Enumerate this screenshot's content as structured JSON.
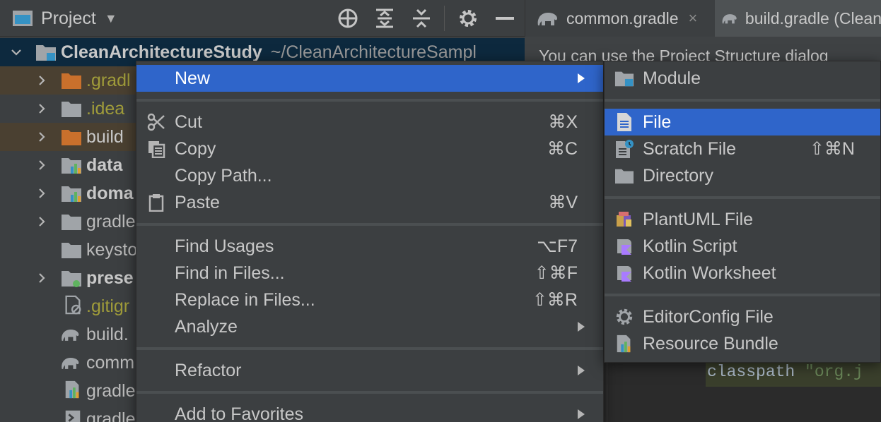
{
  "project_header": {
    "title": "Project"
  },
  "tree": [
    {
      "label": "CleanArchitectureStudy",
      "path": "~/CleanArchitectureSampl",
      "icon": "module-folder-icon"
    },
    {
      "label": ".gradl",
      "icon": "orange-folder-icon"
    },
    {
      "label": ".idea",
      "icon": "folder-icon"
    },
    {
      "label": "build",
      "icon": "orange-folder-icon"
    },
    {
      "label": "data",
      "icon": "module-folder-icon"
    },
    {
      "label": "doma",
      "icon": "module-folder-icon"
    },
    {
      "label": "gradle",
      "icon": "folder-icon"
    },
    {
      "label": "keysto",
      "icon": "folder-icon"
    },
    {
      "label": "prese",
      "icon": "app-module-folder-icon"
    },
    {
      "label": ".gitigr",
      "icon": "gitignore-file-icon"
    },
    {
      "label": "build.",
      "icon": "gradle-elephant-icon"
    },
    {
      "label": "comm",
      "icon": "gradle-elephant-icon"
    },
    {
      "label": "gradle",
      "icon": "properties-file-icon"
    },
    {
      "label": "gradle",
      "icon": "script-file-icon"
    }
  ],
  "editor": {
    "tabs": [
      {
        "label": "common.gradle",
        "close": "×"
      },
      {
        "label": "build.gradle (Clean"
      }
    ],
    "banner": "You can use the Project Structure dialog",
    "code": {
      "keyword": "classpath",
      "string": "\"org.j"
    }
  },
  "context_menu": {
    "items": [
      {
        "label": "New",
        "shortcut": "",
        "submenu": true
      },
      {
        "label": "Cut",
        "shortcut": "⌘X",
        "icon": "scissors-icon"
      },
      {
        "label": "Copy",
        "shortcut": "⌘C",
        "icon": "copy-icon"
      },
      {
        "label": "Copy Path...",
        "shortcut": ""
      },
      {
        "label": "Paste",
        "shortcut": "⌘V",
        "icon": "clipboard-icon"
      },
      {
        "label": "Find Usages",
        "shortcut": "⌥F7"
      },
      {
        "label": "Find in Files...",
        "shortcut": "⇧⌘F"
      },
      {
        "label": "Replace in Files...",
        "shortcut": "⇧⌘R"
      },
      {
        "label": "Analyze",
        "shortcut": "",
        "submenu": true
      },
      {
        "label": "Refactor",
        "shortcut": "",
        "submenu": true
      },
      {
        "label": "Add to Favorites",
        "shortcut": "",
        "submenu": true
      }
    ]
  },
  "new_submenu": {
    "items": [
      {
        "label": "Module",
        "icon": "module-icon",
        "shortcut": ""
      },
      {
        "label": "File",
        "icon": "file-icon",
        "shortcut": ""
      },
      {
        "label": "Scratch File",
        "icon": "scratch-file-icon",
        "shortcut": "⇧⌘N"
      },
      {
        "label": "Directory",
        "icon": "folder-icon",
        "shortcut": ""
      },
      {
        "label": "PlantUML File",
        "icon": "plantuml-icon",
        "shortcut": ""
      },
      {
        "label": "Kotlin Script",
        "icon": "kotlin-script-icon",
        "shortcut": ""
      },
      {
        "label": "Kotlin Worksheet",
        "icon": "kotlin-worksheet-icon",
        "shortcut": ""
      },
      {
        "label": "EditorConfig File",
        "icon": "gear-icon",
        "shortcut": ""
      },
      {
        "label": "Resource Bundle",
        "icon": "resource-bundle-icon",
        "shortcut": ""
      }
    ]
  },
  "colors": {
    "menu_highlight": "#2f65ca",
    "panel_bg": "#3c3f41",
    "editor_bg": "#2b2b2b",
    "folder_gray": "#a0a4a8",
    "folder_orange": "#c9702c",
    "module_blue": "#3592c4"
  }
}
